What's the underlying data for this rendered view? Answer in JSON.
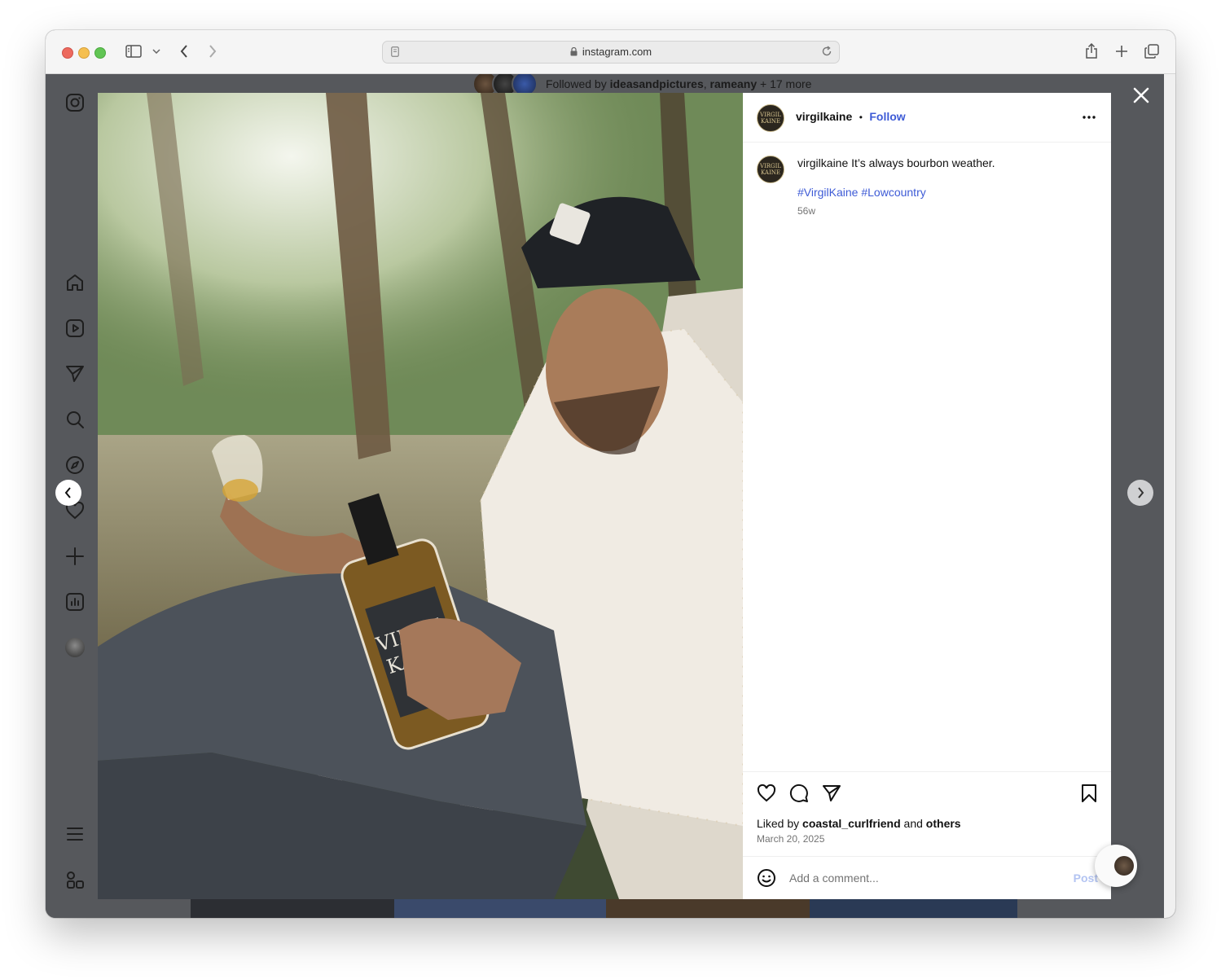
{
  "browser": {
    "url": "instagram.com"
  },
  "followed_bar": {
    "prefix": "Followed by",
    "user1": "ideasandpictures",
    "sep": ",",
    "user2": "rameany",
    "suffix": "+ 17 more"
  },
  "post": {
    "author": "virgilkaine",
    "dot": "•",
    "follow_label": "Follow",
    "caption_author": "virgilkaine",
    "caption_text": "It’s always bourbon weather.",
    "hashtags": "#VirgilKaine #Lowcountry",
    "age": "56w",
    "liked_prefix": "Liked by",
    "liked_user": "coastal_curlfriend",
    "liked_and": "and",
    "liked_others": "others",
    "date": "March 20, 2025",
    "comment_placeholder": "Add a comment...",
    "post_label": "Post"
  },
  "nav_icons": [
    "instagram-icon",
    "home-icon",
    "reels-icon",
    "send-icon",
    "search-icon",
    "explore-icon",
    "heart-icon",
    "create-icon",
    "insights-icon",
    "profile-avatar",
    "menu-icon",
    "meta-icon"
  ],
  "colors": {
    "link": "#3e5bd6",
    "overlay": "#56585c"
  }
}
